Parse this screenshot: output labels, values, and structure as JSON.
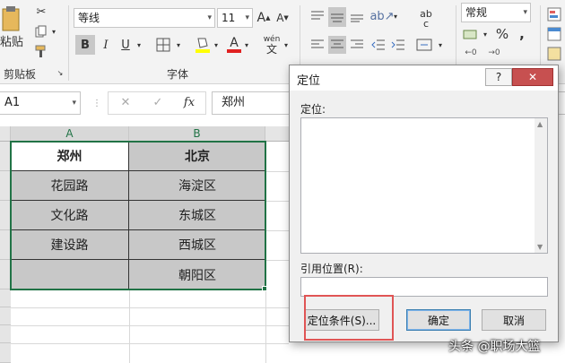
{
  "ribbon": {
    "clipboard": {
      "paste_label": "粘贴",
      "group_label": "剪贴板"
    },
    "font": {
      "family": "等线",
      "size": "11",
      "bold": "B",
      "italic": "I",
      "underline": "U",
      "group_label": "字体",
      "wen_label": "wén",
      "grow": "A",
      "shrink": "A",
      "color_a": "A"
    },
    "number": {
      "format": "常规",
      "percent": "%",
      "comma": ","
    },
    "align": {
      "ab": "ab",
      "c": "c"
    }
  },
  "formula_bar": {
    "name_box": "A1",
    "fx": "fx",
    "content": "郑州"
  },
  "sheet": {
    "columns": [
      "A",
      "B"
    ],
    "rows": [
      [
        "郑州",
        "北京"
      ],
      [
        "花园路",
        "海淀区"
      ],
      [
        "文化路",
        "东城区"
      ],
      [
        "建设路",
        "西城区"
      ],
      [
        "",
        "朝阳区"
      ]
    ]
  },
  "dialog": {
    "title": "定位",
    "help": "?",
    "close": "✕",
    "list_label": "定位:",
    "ref_label": "引用位置(R):",
    "ref_value": "",
    "special_button": "定位条件(S)...",
    "ok_button": "确定",
    "cancel_button": "取消"
  },
  "watermark": "头条 @职场大篮",
  "colors": {
    "highlight": "#e05555",
    "cell_fill": "#c8c8c8",
    "selection": "#217346"
  }
}
